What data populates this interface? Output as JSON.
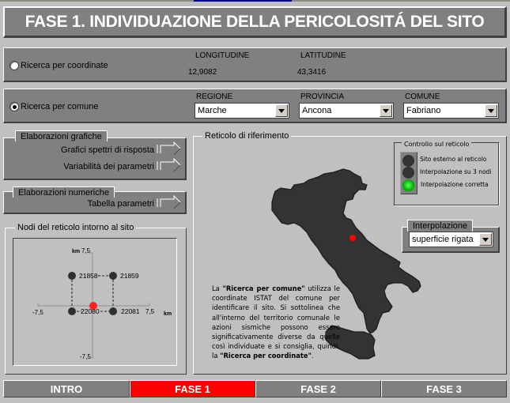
{
  "title": "FASE 1. INDIVIDUAZIONE DELLA PERICOLOSITÁ DEL SITO",
  "search_coord": {
    "radio_label": "Ricerca per coordinate",
    "selected": false,
    "longitude_label": "LONGITUDINE",
    "longitude_value": "12,9082",
    "latitude_label": "LATITUDINE",
    "latitude_value": "43,3416"
  },
  "search_comune": {
    "radio_label": "Ricerca per comune",
    "selected": true,
    "regione_label": "REGIONE",
    "regione_value": "Marche",
    "provincia_label": "PROVINCIA",
    "provincia_value": "Ancona",
    "comune_label": "COMUNE",
    "comune_value": "Fabriano"
  },
  "elaborazioni_grafiche": {
    "title": "Elaborazioni grafiche",
    "items": [
      {
        "label": "Grafici spettri di risposta"
      },
      {
        "label": "Variabilità dei parametri"
      }
    ]
  },
  "elaborazioni_numeriche": {
    "title": "Elaborazioni numeriche",
    "items": [
      {
        "label": "Tabella parametri"
      }
    ]
  },
  "nodi": {
    "title": "Nodi del reticolo intorno al sito",
    "axis_unit": "km",
    "axis_min": "-7,5",
    "axis_max": "7,5",
    "nodes": [
      {
        "id": "21858"
      },
      {
        "id": "21859"
      },
      {
        "id": "22080"
      },
      {
        "id": "22081"
      }
    ]
  },
  "reticolo": {
    "title": "Reticolo di riferimento",
    "description_parts": {
      "p1": "La ",
      "b1": "\"Ricerca per comune\"",
      "p2": " utilizza le coordinate ISTAT del comune per identificare il sito. Si sottolinea che all'interno del territorio comunale le azioni sismiche possono essere significativamente diverse da quelle così individuate e si consiglia, quindi, la ",
      "b2": "\"Ricerca per coordinate\"",
      "p3": "."
    }
  },
  "controllo": {
    "title": "Controllo sul reticolo",
    "lights": [
      {
        "label": "Sito esterno al reticolo",
        "state": "off"
      },
      {
        "label": "Interpolazione su 3 nodi",
        "state": "off"
      },
      {
        "label": "Interpolazione corretta",
        "state": "on"
      }
    ],
    "on_color": "#00c800"
  },
  "interpolazione": {
    "title": "Interpolazione",
    "value": "superficie rigata"
  },
  "nav": {
    "tabs": [
      {
        "label": "INTRO",
        "active": false
      },
      {
        "label": "FASE 1",
        "active": true
      },
      {
        "label": "FASE 2",
        "active": false
      },
      {
        "label": "FASE 3",
        "active": false
      }
    ],
    "active_color": "#ff0000"
  }
}
